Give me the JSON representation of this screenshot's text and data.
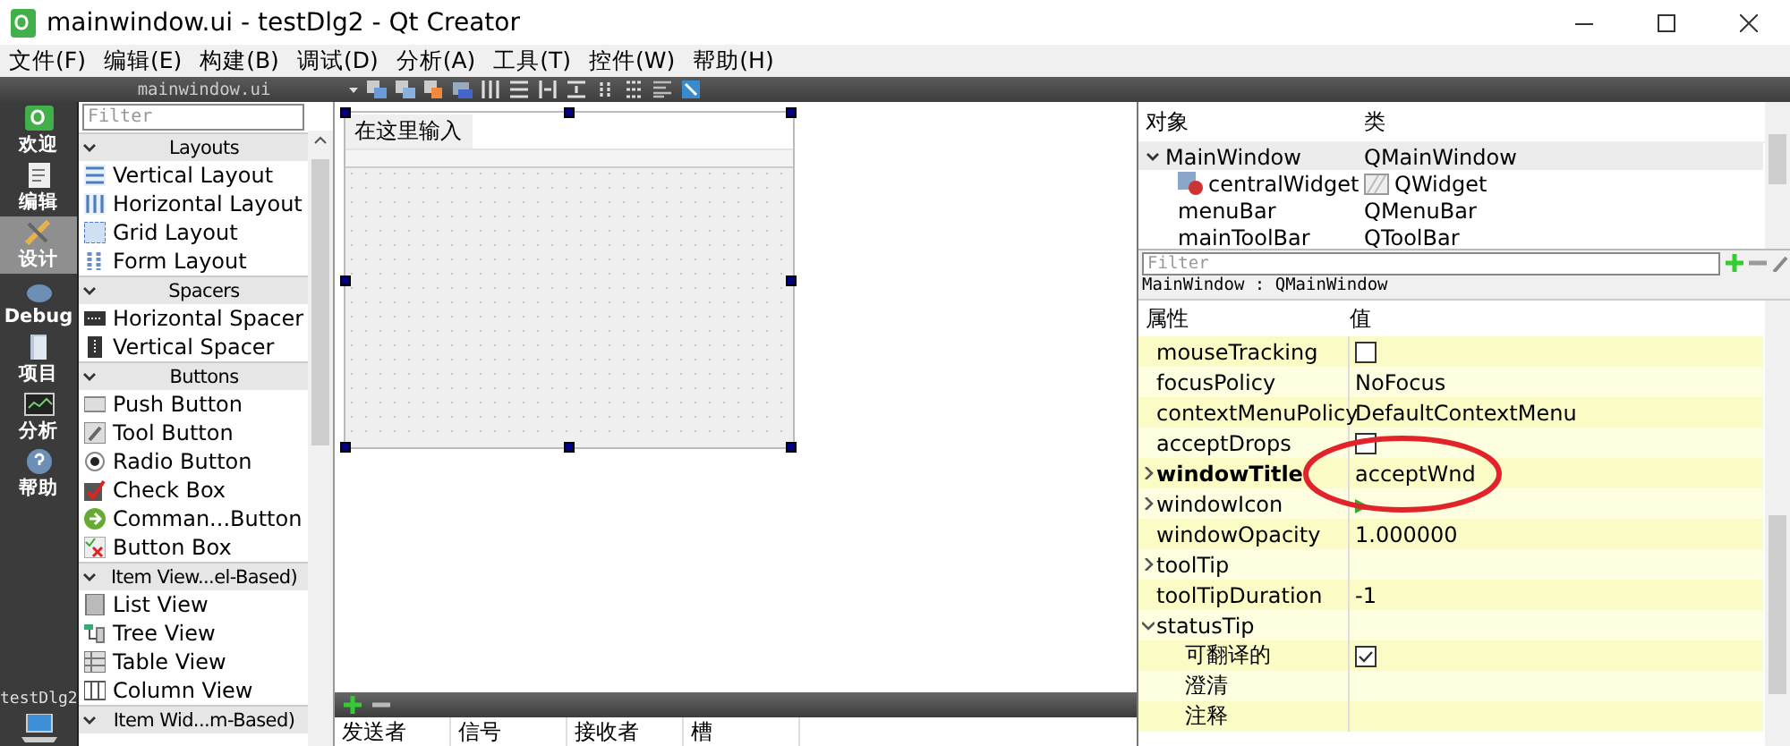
{
  "window": {
    "title": "mainwindow.ui - testDlg2 - Qt Creator"
  },
  "menu": [
    "文件(F)",
    "编辑(E)",
    "构建(B)",
    "调试(D)",
    "分析(A)",
    "工具(T)",
    "控件(W)",
    "帮助(H)"
  ],
  "editor_tab": "mainwindow.ui",
  "modes": [
    {
      "label": "欢迎",
      "selected": false
    },
    {
      "label": "编辑",
      "selected": false
    },
    {
      "label": "设计",
      "selected": true
    },
    {
      "label": "Debug",
      "selected": false
    },
    {
      "label": "项目",
      "selected": false
    },
    {
      "label": "分析",
      "selected": false
    },
    {
      "label": "帮助",
      "selected": false
    }
  ],
  "project": "testDlg2",
  "widget_box": {
    "filter_placeholder": "Filter",
    "categories": [
      {
        "title": "Layouts",
        "expanded": true,
        "items": [
          "Vertical Layout",
          "Horizontal Layout",
          "Grid Layout",
          "Form Layout"
        ]
      },
      {
        "title": "Spacers",
        "expanded": true,
        "items": [
          "Horizontal Spacer",
          "Vertical Spacer"
        ]
      },
      {
        "title": "Buttons",
        "expanded": true,
        "items": [
          "Push Button",
          "Tool Button",
          "Radio Button",
          "Check Box",
          "Comman...Button",
          "Button Box"
        ]
      },
      {
        "title": "Item View...el-Based)",
        "expanded": true,
        "items": [
          "List View",
          "Tree View",
          "Table View",
          "Column View"
        ]
      },
      {
        "title": "Item Wid...m-Based)",
        "expanded": true
      }
    ]
  },
  "form": {
    "menu_placeholder": "在这里输入"
  },
  "signals_table": {
    "columns": [
      "发送者",
      "信号",
      "接收者",
      "槽"
    ]
  },
  "object_inspector": {
    "columns": [
      "对象",
      "类"
    ],
    "rows": [
      {
        "object": "MainWindow",
        "class": "QMainWindow",
        "selected": true,
        "expanded": true,
        "children": [
          {
            "object": "centralWidget",
            "class": "QWidget",
            "selected": false
          },
          {
            "object": "menuBar",
            "class": "QMenuBar",
            "selected": false
          },
          {
            "object": "mainToolBar",
            "class": "QToolBar",
            "selected": false
          }
        ]
      }
    ]
  },
  "property_editor": {
    "filter_placeholder": "Filter",
    "context": "MainWindow : QMainWindow",
    "columns": [
      "属性",
      "值"
    ],
    "rows": [
      {
        "name": "mouseTracking",
        "kind": "checkbox",
        "checked": false,
        "modified": false,
        "circled": false
      },
      {
        "name": "focusPolicy",
        "kind": "text",
        "value": "NoFocus",
        "modified": false,
        "circled": false
      },
      {
        "name": "contextMenuPolicy",
        "kind": "text",
        "value": "DefaultContextMenu",
        "modified": false,
        "circled": false
      },
      {
        "name": "acceptDrops",
        "kind": "checkbox",
        "checked": false,
        "modified": false,
        "circled": false
      },
      {
        "name": "windowTitle",
        "kind": "text",
        "value": "acceptWnd",
        "modified": true,
        "circled": true,
        "expanded": false
      },
      {
        "name": "windowIcon",
        "kind": "icon",
        "modified": false,
        "circled": false,
        "expanded": false
      },
      {
        "name": "windowOpacity",
        "kind": "text",
        "value": "1.000000",
        "modified": false,
        "circled": false
      },
      {
        "name": "toolTip",
        "kind": "text",
        "modified": false,
        "circled": false,
        "expanded": false
      },
      {
        "name": "toolTipDuration",
        "kind": "text",
        "value": "-1",
        "modified": false,
        "circled": false
      },
      {
        "name": "statusTip",
        "kind": "text",
        "modified": false,
        "circled": false,
        "expanded": true,
        "children": [
          {
            "name": "可翻译的",
            "kind": "checkbox",
            "checked": true,
            "modified": false,
            "circled": false
          },
          {
            "name": "澄清",
            "kind": "text",
            "modified": false,
            "circled": false
          },
          {
            "name": "注释",
            "kind": "text",
            "modified": false,
            "circled": false
          }
        ]
      }
    ]
  }
}
